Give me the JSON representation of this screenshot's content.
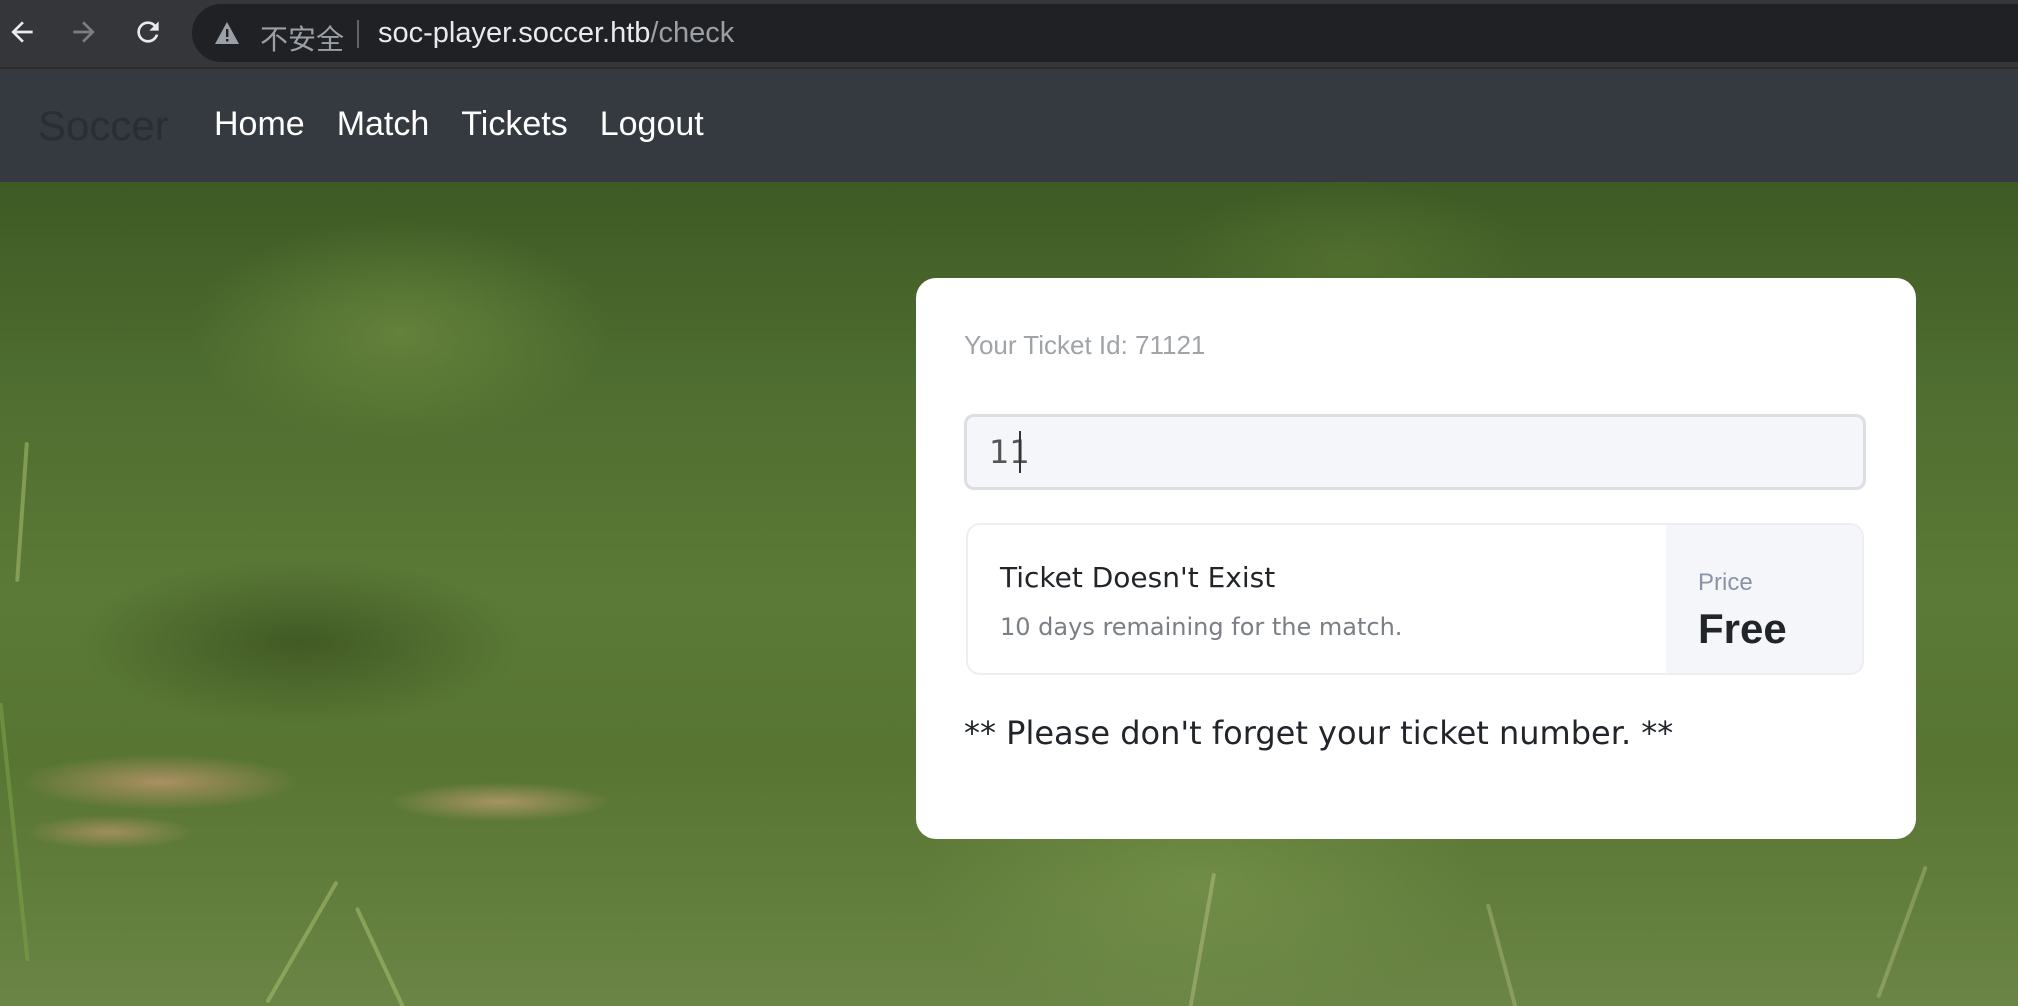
{
  "browser": {
    "security_label": "不安全",
    "url_host": "soc-player.soccer.htb",
    "url_path": "/check"
  },
  "navbar": {
    "brand": "Soccer",
    "links": [
      {
        "label": "Home"
      },
      {
        "label": "Match"
      },
      {
        "label": "Tickets"
      },
      {
        "label": "Logout"
      }
    ]
  },
  "ticket_card": {
    "ticket_id_label": "Your Ticket Id: 71121",
    "input_value": "11",
    "result": {
      "title": "Ticket Doesn't Exist",
      "subtitle": "10 days remaining for the match.",
      "price_label": "Price",
      "price_value": "Free"
    },
    "note": "** Please don't forget your ticket number. **"
  },
  "colors": {
    "navbar_bg": "#343a40",
    "chrome_bg": "#35363a",
    "card_bg": "#ffffff",
    "input_bg": "#f5f6fa"
  }
}
